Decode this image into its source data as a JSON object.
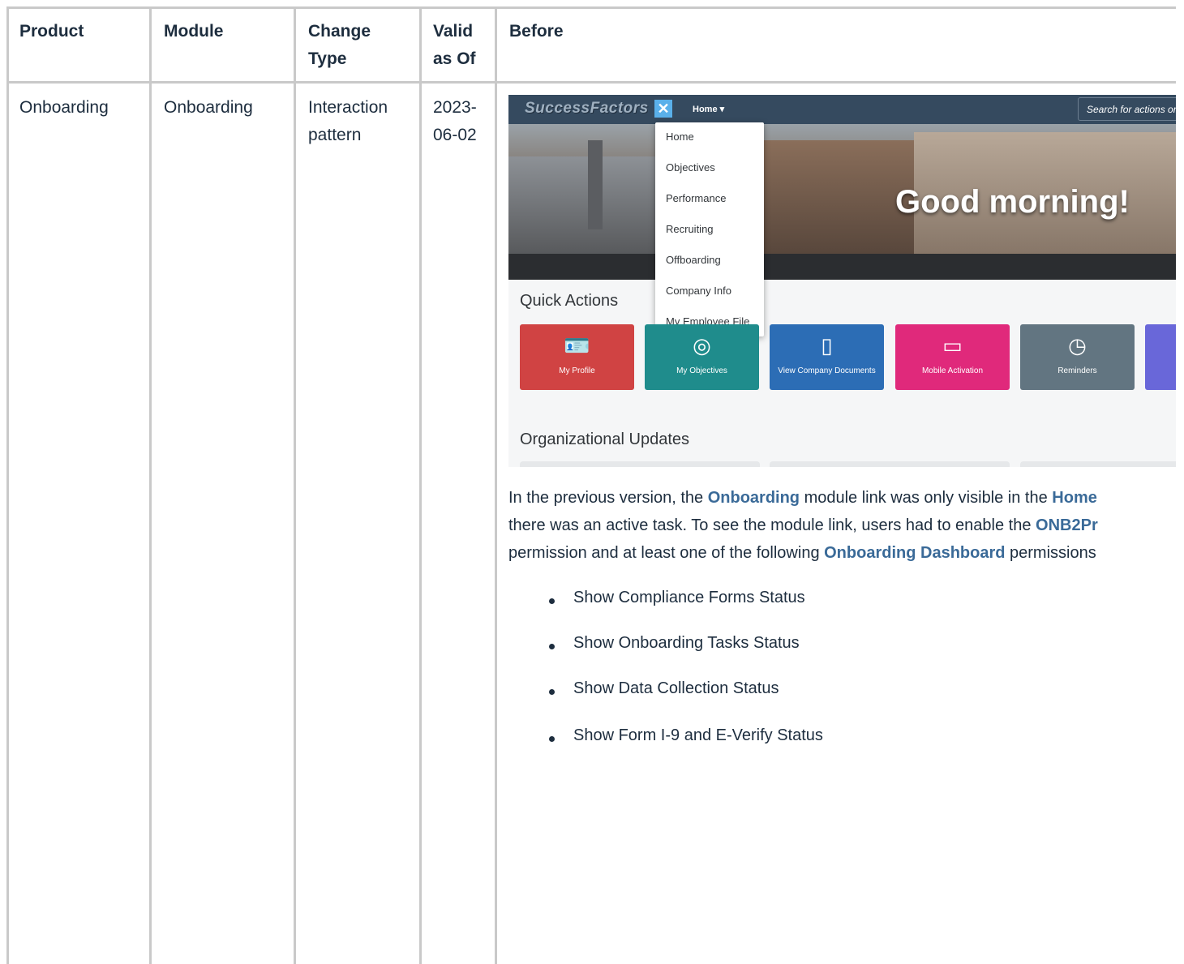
{
  "table": {
    "headers": {
      "product": "Product",
      "module": "Module",
      "change_type_1": "Change",
      "change_type_2": "Type",
      "valid_1": "Valid",
      "valid_2": "as Of",
      "before": "Before"
    },
    "row": {
      "product": "Onboarding",
      "module": "Onboarding",
      "change_type_1": "Interaction",
      "change_type_2": "pattern",
      "valid_1": "2023-",
      "valid_2": "06-02"
    }
  },
  "screenshot": {
    "logo": "SuccessFactors",
    "home_menu": "Home ▾",
    "search_placeholder": "Search for actions or",
    "greeting": "Good morning!",
    "menu_items": [
      "Home",
      "Objectives",
      "Performance",
      "Recruiting",
      "Offboarding",
      "Company Info",
      "My Employee File"
    ],
    "quick_actions_title": "Quick Actions",
    "tiles": [
      {
        "label": "My Profile",
        "icon": "profile-card-icon",
        "color": "#d04343"
      },
      {
        "label": "My Objectives",
        "icon": "target-icon",
        "color": "#1f8c8c"
      },
      {
        "label": "View Company Documents",
        "icon": "document-icon",
        "color": "#2c6db5"
      },
      {
        "label": "Mobile Activation",
        "icon": "devices-icon",
        "color": "#e0297b"
      },
      {
        "label": "Reminders",
        "icon": "reminder-icon",
        "color": "#627581"
      },
      {
        "label": "",
        "icon": "",
        "color": "#6967d9"
      }
    ],
    "org_updates_title": "Organizational Updates"
  },
  "description": {
    "line1_a": "In the previous version, the ",
    "line1_link1": "Onboarding",
    "line1_b": " module link was only visible in the ",
    "line1_link2": "Home",
    "line2_a": "there was an active task. To see the module link, users had to enable the ",
    "line2_link": "ONB2Pr",
    "line3_a": "permission and at least one of the following ",
    "line3_link": "Onboarding Dashboard",
    "line3_b": " permissions",
    "bullets": [
      "Show Compliance Forms Status",
      "Show Onboarding Tasks Status",
      "Show Data Collection Status",
      "Show Form I-9 and E-Verify Status"
    ]
  }
}
